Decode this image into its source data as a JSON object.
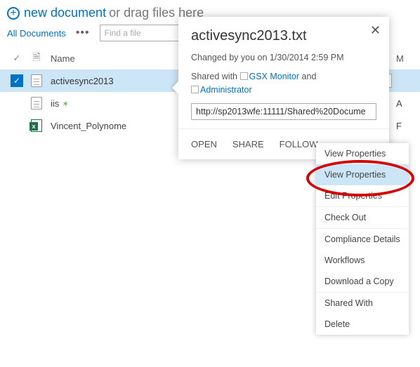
{
  "header": {
    "new_doc": "new document",
    "or_drag": "or drag files here"
  },
  "toolbar": {
    "view": "All Documents",
    "find_placeholder": "Find a file"
  },
  "columns": {
    "name": "Name",
    "modified_initial": "M"
  },
  "rows": [
    {
      "name": "activesync2013",
      "type": "txt",
      "new": false,
      "mod_initial": ""
    },
    {
      "name": "iis",
      "type": "txt",
      "new": true,
      "mod_initial": "A"
    },
    {
      "name": "Vincent_Polynome",
      "type": "xls",
      "new": false,
      "mod_initial": "F"
    }
  ],
  "callout": {
    "title": "activesync2013.txt",
    "changed": "Changed by you on 1/30/2014 2:59 PM",
    "shared_prefix": "Shared with",
    "share1": "GSX Monitor",
    "and": "and",
    "share2": "Administrator",
    "url": "http://sp2013wfe:11111/Shared%20Docume",
    "actions": {
      "open": "OPEN",
      "share": "SHARE",
      "follow": "FOLLOW"
    }
  },
  "menu": {
    "items_a": [
      "View Properties",
      "View Properties",
      "Edit Properties"
    ],
    "items_b": [
      "Check Out"
    ],
    "items_c": [
      "Compliance Details",
      "Workflows",
      "Download a Copy"
    ],
    "items_d": [
      "Shared With",
      "Delete"
    ]
  }
}
